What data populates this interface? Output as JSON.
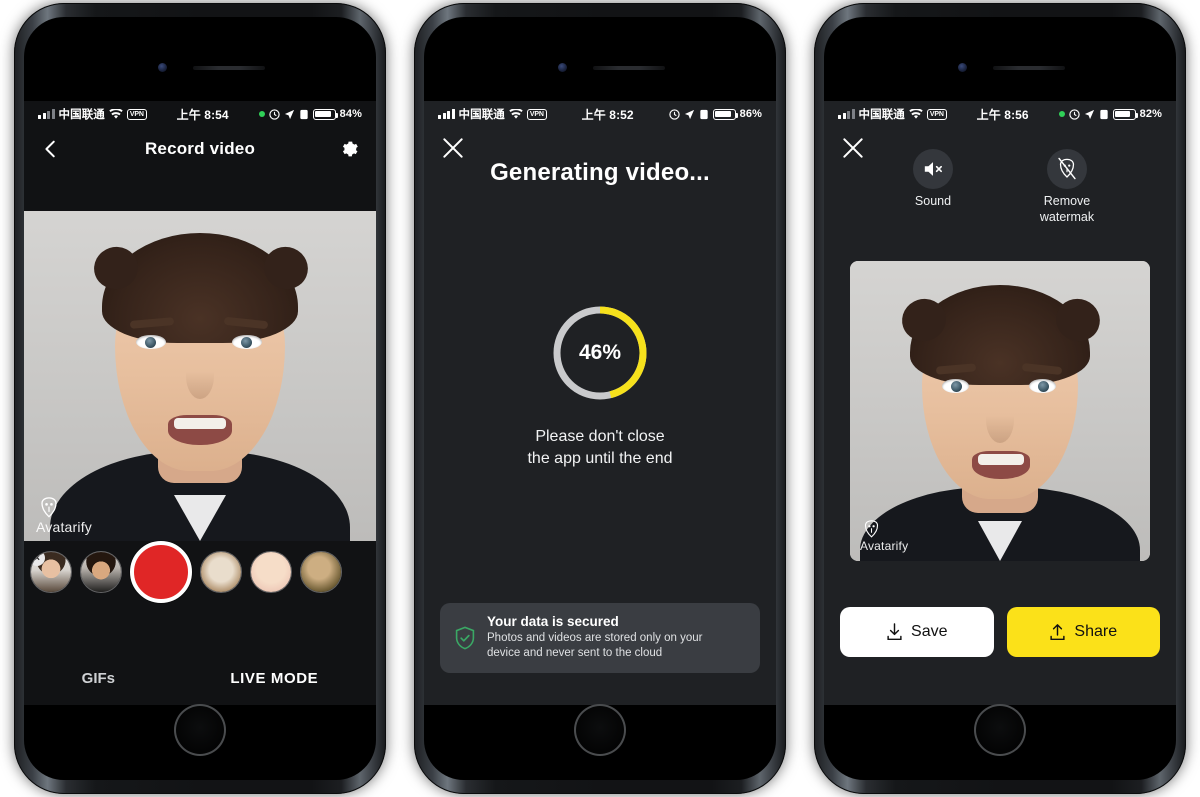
{
  "app": {
    "name": "Avatarify",
    "watermark": "Avatarify"
  },
  "colors": {
    "accent_yellow": "#fbe119",
    "record_red": "#e02626",
    "screen_bg": "#1f2124",
    "panel_bg": "#3a3d42",
    "shield_green": "#3aa865",
    "ring_track": "#c9cacc",
    "status_green": "#30d158"
  },
  "phones": [
    {
      "id": "record-video",
      "status_bar": {
        "carrier": "中国联通",
        "vpn_badge": "VPN",
        "time": "上午 8:54",
        "battery_percent": "84%",
        "battery_level": 84,
        "has_green_dot": true,
        "icons": [
          "signal-bars-icon",
          "wifi-icon",
          "vpn-badge-icon",
          "clock-icon",
          "location-arrow-icon",
          "alarm-icon",
          "battery-icon"
        ]
      },
      "navbar": {
        "back": "back-chevron-icon",
        "title": "Record video",
        "settings": "gear-icon"
      },
      "carousel": {
        "items": [
          {
            "name": "avatar-man-glasses",
            "removable": true,
            "remove_label": "×",
            "selected": false
          },
          {
            "name": "avatar-man-dark-hair",
            "removable": false,
            "selected": false
          },
          {
            "name": "avatar-dog",
            "removable": false,
            "selected": false
          },
          {
            "name": "avatar-baby",
            "removable": false,
            "selected": false
          },
          {
            "name": "avatar-painting",
            "removable": false,
            "selected": false
          }
        ],
        "record_button": "record-button"
      },
      "tabs": [
        {
          "label": "GIFs",
          "active": false
        },
        {
          "label": "LIVE MODE",
          "active": true
        }
      ]
    },
    {
      "id": "generating-video",
      "status_bar": {
        "carrier": "中国联通",
        "vpn_badge": "VPN",
        "time": "上午 8:52",
        "battery_percent": "86%",
        "battery_level": 86,
        "has_green_dot": false
      },
      "close_button": "close-icon",
      "title": "Generating video...",
      "progress": {
        "value": 46,
        "label": "46%"
      },
      "message_line1": "Please don't close",
      "message_line2": "the app until the end",
      "notice": {
        "icon": "shield-check-icon",
        "title": "Your data is secured",
        "body_line1": "Photos and videos are stored only on your",
        "body_line2": "device and never sent to the cloud"
      }
    },
    {
      "id": "result-share",
      "status_bar": {
        "carrier": "中国联通",
        "vpn_badge": "VPN",
        "time": "上午 8:56",
        "battery_percent": "82%",
        "battery_level": 82,
        "has_green_dot": true
      },
      "close_button": "close-icon",
      "tools": [
        {
          "icon": "speaker-mute-icon",
          "label_line1": "Sound",
          "label_line2": ""
        },
        {
          "icon": "watermark-off-icon",
          "label_line1": "Remove",
          "label_line2": "watermak"
        }
      ],
      "actions": [
        {
          "id": "save",
          "label": "Save",
          "icon": "download-icon",
          "style": "light"
        },
        {
          "id": "share",
          "label": "Share",
          "icon": "upload-icon",
          "style": "accent"
        }
      ]
    }
  ]
}
